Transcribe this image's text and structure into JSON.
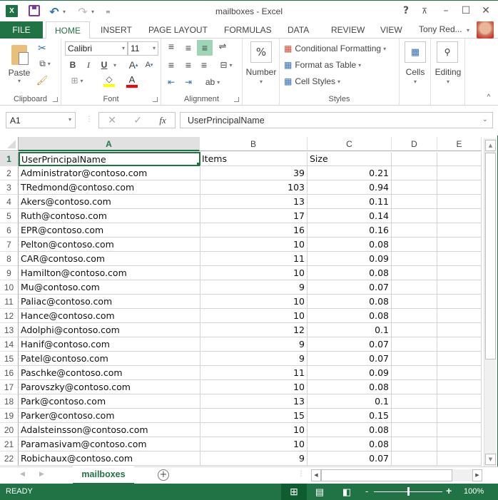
{
  "window": {
    "title": "mailboxes - Excel",
    "user_name": "Tony Red...",
    "help_label": "?",
    "app_icon_label": "X"
  },
  "tabs": [
    {
      "label": "FILE"
    },
    {
      "label": "HOME"
    },
    {
      "label": "INSERT"
    },
    {
      "label": "PAGE LAYOUT"
    },
    {
      "label": "FORMULAS"
    },
    {
      "label": "DATA"
    },
    {
      "label": "REVIEW"
    },
    {
      "label": "VIEW"
    }
  ],
  "ribbon": {
    "clipboard": {
      "label": "Clipboard",
      "paste": "Paste"
    },
    "font": {
      "label": "Font",
      "font_name": "Calibri",
      "font_size": "11",
      "bold": "B",
      "italic": "I",
      "underline": "U",
      "highlight_color": "#ffff00",
      "font_color": "#ff0000"
    },
    "alignment": {
      "label": "Alignment"
    },
    "number": {
      "label": "Number",
      "icon_text": "%"
    },
    "styles": {
      "label": "Styles",
      "conditional": "Conditional Formatting",
      "format_table": "Format as Table",
      "cell_styles": "Cell Styles"
    },
    "cells": {
      "label": "Cells"
    },
    "editing": {
      "label": "Editing"
    }
  },
  "formula_bar": {
    "name_box": "A1",
    "fx": "fx",
    "value": "UserPrincipalName"
  },
  "sheet": {
    "columns": [
      "A",
      "B",
      "C",
      "D",
      "E"
    ],
    "header": {
      "A": "UserPrincipalName",
      "B": "Items",
      "C": "Size"
    },
    "rows": [
      {
        "n": "2",
        "a": "Administrator@contoso.com",
        "b": "39",
        "c": "0.21"
      },
      {
        "n": "3",
        "a": "TRedmond@contoso.com",
        "b": "103",
        "c": "0.94"
      },
      {
        "n": "4",
        "a": "Akers@contoso.com",
        "b": "13",
        "c": "0.11"
      },
      {
        "n": "5",
        "a": "Ruth@contoso.com",
        "b": "17",
        "c": "0.14"
      },
      {
        "n": "6",
        "a": "EPR@contoso.com",
        "b": "16",
        "c": "0.16"
      },
      {
        "n": "7",
        "a": "Pelton@contoso.com",
        "b": "10",
        "c": "0.08"
      },
      {
        "n": "8",
        "a": "CAR@contoso.com",
        "b": "11",
        "c": "0.09"
      },
      {
        "n": "9",
        "a": "Hamilton@contoso.com",
        "b": "10",
        "c": "0.08"
      },
      {
        "n": "10",
        "a": "Mu@contoso.com",
        "b": "9",
        "c": "0.07"
      },
      {
        "n": "11",
        "a": "Paliac@contoso.com",
        "b": "10",
        "c": "0.08"
      },
      {
        "n": "12",
        "a": "Hance@contoso.com",
        "b": "10",
        "c": "0.08"
      },
      {
        "n": "13",
        "a": "Adolphi@contoso.com",
        "b": "12",
        "c": "0.1"
      },
      {
        "n": "14",
        "a": "Hanif@contoso.com",
        "b": "9",
        "c": "0.07"
      },
      {
        "n": "15",
        "a": "Patel@contoso.com",
        "b": "9",
        "c": "0.07"
      },
      {
        "n": "16",
        "a": "Paschke@contoso.com",
        "b": "11",
        "c": "0.09"
      },
      {
        "n": "17",
        "a": "Parovszky@contoso.com",
        "b": "10",
        "c": "0.08"
      },
      {
        "n": "18",
        "a": "Park@contoso.com",
        "b": "13",
        "c": "0.1"
      },
      {
        "n": "19",
        "a": "Parker@contoso.com",
        "b": "15",
        "c": "0.15"
      },
      {
        "n": "20",
        "a": "Adalsteinsson@contoso.com",
        "b": "10",
        "c": "0.08"
      },
      {
        "n": "21",
        "a": "Paramasivam@contoso.com",
        "b": "10",
        "c": "0.08"
      },
      {
        "n": "22",
        "a": "Robichaux@contoso.com",
        "b": "9",
        "c": "0.07"
      }
    ],
    "tab_name": "mailboxes"
  },
  "status": {
    "ready": "READY",
    "zoom": "100%",
    "zoom_fraction": 0.5
  },
  "colors": {
    "accent": "#217346"
  }
}
